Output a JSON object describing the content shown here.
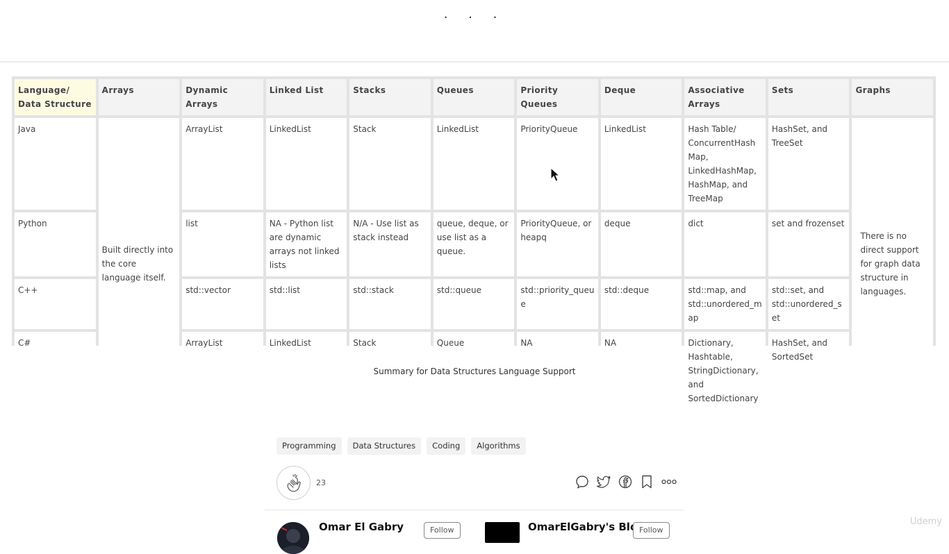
{
  "top": {
    "ellipsis": ". . ."
  },
  "table": {
    "headers": [
      "Language/ Data Structure",
      "Arrays",
      "Dynamic Arrays",
      "Linked List",
      "Stacks",
      "Queues",
      "Priority Queues",
      "Deque",
      "Associative Arrays",
      "Sets",
      "Graphs"
    ],
    "arrays_note": "Built directly into the core language itself.",
    "graphs_note": "There is no direct support for graph data structure in languages.",
    "rows": [
      {
        "lang": "Java",
        "dyn": "ArrayList",
        "linked": "LinkedList",
        "stack": "Stack",
        "queue": "LinkedList",
        "pq": "PriorityQueue",
        "deque": "LinkedList",
        "assoc": "Hash Table/ ConcurrentHashMap, LinkedHashMap, HashMap, and TreeMap",
        "sets": "HashSet, and TreeSet"
      },
      {
        "lang": "Python",
        "dyn": "list",
        "linked": "NA - Python list are dynamic arrays not linked lists",
        "stack": "N/A - Use list as stack instead",
        "queue": "queue, deque, or use list as a queue.",
        "pq": "PriorityQueue, or heapq",
        "deque": "deque",
        "assoc": "dict",
        "sets": "set and frozenset"
      },
      {
        "lang": "C++",
        "dyn": "std::vector",
        "linked": "std::list",
        "stack": "std::stack",
        "queue": "std::queue",
        "pq": "std::priority_queue",
        "deque": "std::deque",
        "assoc": "std::map, and std::unordered_map",
        "sets": "std::set, and std::unordered_set"
      },
      {
        "lang": "C#",
        "dyn": "ArrayList",
        "linked": "LinkedList",
        "stack": "Stack",
        "queue": "Queue",
        "pq": "NA",
        "deque": "NA",
        "assoc": "Dictionary, Hashtable, StringDictionary,  and SortedDictionary",
        "sets": "HashSet, and SortedSet"
      }
    ]
  },
  "caption": "Summary for Data Structures Language Support",
  "tags": [
    "Programming",
    "Data Structures",
    "Coding",
    "Algorithms"
  ],
  "claps": {
    "count": "23",
    "icon": "clap-icon"
  },
  "actions": [
    "comment-icon",
    "twitter-icon",
    "facebook-icon",
    "bookmark-icon",
    "more-icon"
  ],
  "footer": {
    "author": "Omar El Gabry",
    "follow_label": "Follow",
    "blog": "OmarElGabry's Blog",
    "blog_follow_label": "Follow"
  },
  "watermark": "Udemy"
}
